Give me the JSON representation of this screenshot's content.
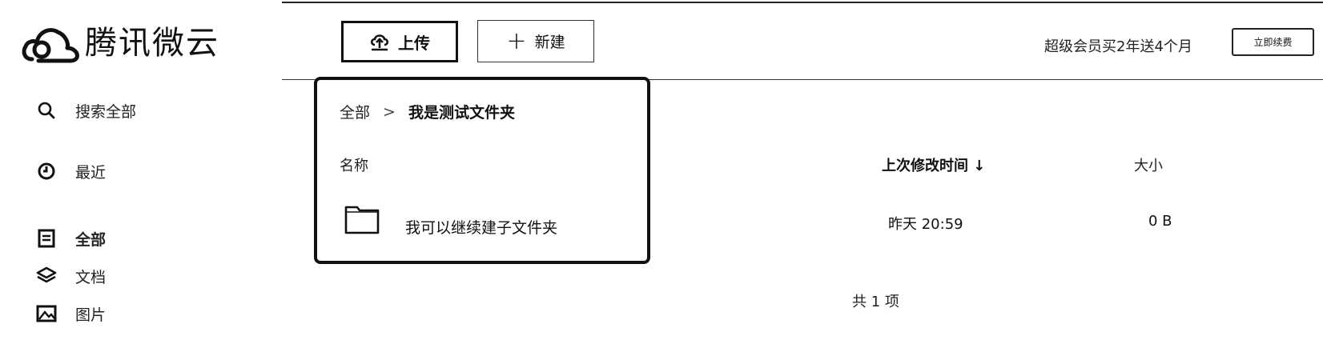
{
  "app": {
    "logo_text": "腾讯微云"
  },
  "sidebar": {
    "items": [
      {
        "label": "搜索全部",
        "icon": "search-icon"
      },
      {
        "label": "最近",
        "icon": "clock-icon"
      },
      {
        "label": "全部",
        "icon": "document-list-icon",
        "active": true
      },
      {
        "label": "文档",
        "icon": "layers-icon"
      },
      {
        "label": "图片",
        "icon": "image-icon"
      }
    ]
  },
  "toolbar": {
    "upload_label": "上传",
    "new_label": "新建",
    "promo_text": "超级会员买2年送4个月",
    "renew_label": "立即续费"
  },
  "breadcrumb": {
    "root": "全部",
    "separator": ">",
    "current": "我是测试文件夹"
  },
  "table": {
    "columns": {
      "name": "名称",
      "modified": "上次修改时间 ↓",
      "size": "大小"
    },
    "rows": [
      {
        "name": "我可以继续建子文件夹",
        "modified": "昨天 20:59",
        "size": "0 B",
        "type": "folder"
      }
    ],
    "total_text": "共 1 项"
  },
  "colors": {
    "border": "#111111",
    "text": "#111111",
    "background": "#ffffff"
  }
}
